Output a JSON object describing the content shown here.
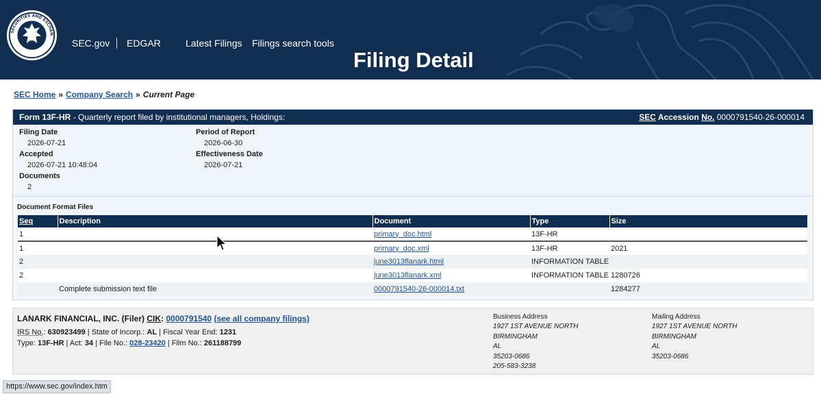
{
  "header": {
    "nav": {
      "secgov": "SEC.gov",
      "edgar": "EDGAR",
      "latest": "Latest Filings",
      "search_tools": "Filings search tools"
    },
    "title": "Filing Detail",
    "seal_text": "SECURITIES AND EXCHANGE COMMISSION"
  },
  "breadcrumb": {
    "home": "SEC Home",
    "company_search": "Company Search",
    "sep": "»",
    "current": "Current Page"
  },
  "form": {
    "form_name": "Form 13F-HR",
    "description": " - Quarterly report filed by institutional managers, Holdings:",
    "accession_sec": "SEC",
    "accession_label": "Accession",
    "accession_no": "No.",
    "accession_value": "0000791540-26-000014",
    "filing_date_label": "Filing Date",
    "filing_date": "2026-07-21",
    "accepted_label": "Accepted",
    "accepted": "2026-07-21 10:48:04",
    "documents_label": "Documents",
    "documents": "2",
    "period_label": "Period of Report",
    "period": "2026-06-30",
    "effectiveness_label": "Effectiveness Date",
    "effectiveness": "2026-07-21"
  },
  "document_format_files": {
    "title": "Document Format Files",
    "columns": [
      "Seq",
      "Description",
      "Document",
      "Type",
      "Size"
    ],
    "rows": [
      {
        "seq": "1",
        "description": "",
        "document": "primary_doc.html",
        "type": "13F-HR",
        "size": ""
      },
      {
        "seq": "1",
        "description": "",
        "document": "primary_doc.xml",
        "type": "13F-HR",
        "size": "2021"
      },
      {
        "seq": "2",
        "description": "",
        "document": "june3013flanark.html",
        "type": "INFORMATION TABLE",
        "size": ""
      },
      {
        "seq": "2",
        "description": "",
        "document": "june3013flanark.xml",
        "type": "INFORMATION TABLE",
        "size": "1280726"
      },
      {
        "seq": "",
        "description": "Complete submission text file",
        "document": "0000791540-26-000014.txt",
        "type": "",
        "size": "1284277"
      }
    ]
  },
  "filer": {
    "name": "LANARK FINANCIAL, INC. (Filer)",
    "cik_label": "CIK",
    "cik": "0000791540",
    "see_all": "(see all company filings)",
    "irs_label": "IRS No.",
    "irs": "630923499",
    "state_label": "State of Incorp.",
    "state": "AL",
    "fiscal_label": "Fiscal Year End",
    "fiscal": "1231",
    "type_label": "Type",
    "type": "13F-HR",
    "act_label": "Act",
    "act": "34",
    "file_no_label": "File No.",
    "file_no": "028-23420",
    "film_no_label": "Film No.",
    "film_no": "261188799",
    "business_address": {
      "label": "Business Address",
      "lines": [
        "1927 1ST AVENUE NORTH",
        "BIRMINGHAM",
        "AL",
        "35203-0686",
        "205-583-3238"
      ]
    },
    "mailing_address": {
      "label": "Mailing Address",
      "lines": [
        "1927 1ST AVENUE NORTH",
        "BIRMINGHAM",
        "AL",
        "35203-0686"
      ]
    }
  },
  "status_bar": {
    "url": "https://www.sec.gov/index.htm"
  },
  "colors": {
    "navy": "#112e51",
    "link": "#205493",
    "panel": "#f1f6fb"
  },
  "icons": [
    "sec-seal-icon",
    "eagle-watermark-icon",
    "mouse-cursor-icon"
  ]
}
